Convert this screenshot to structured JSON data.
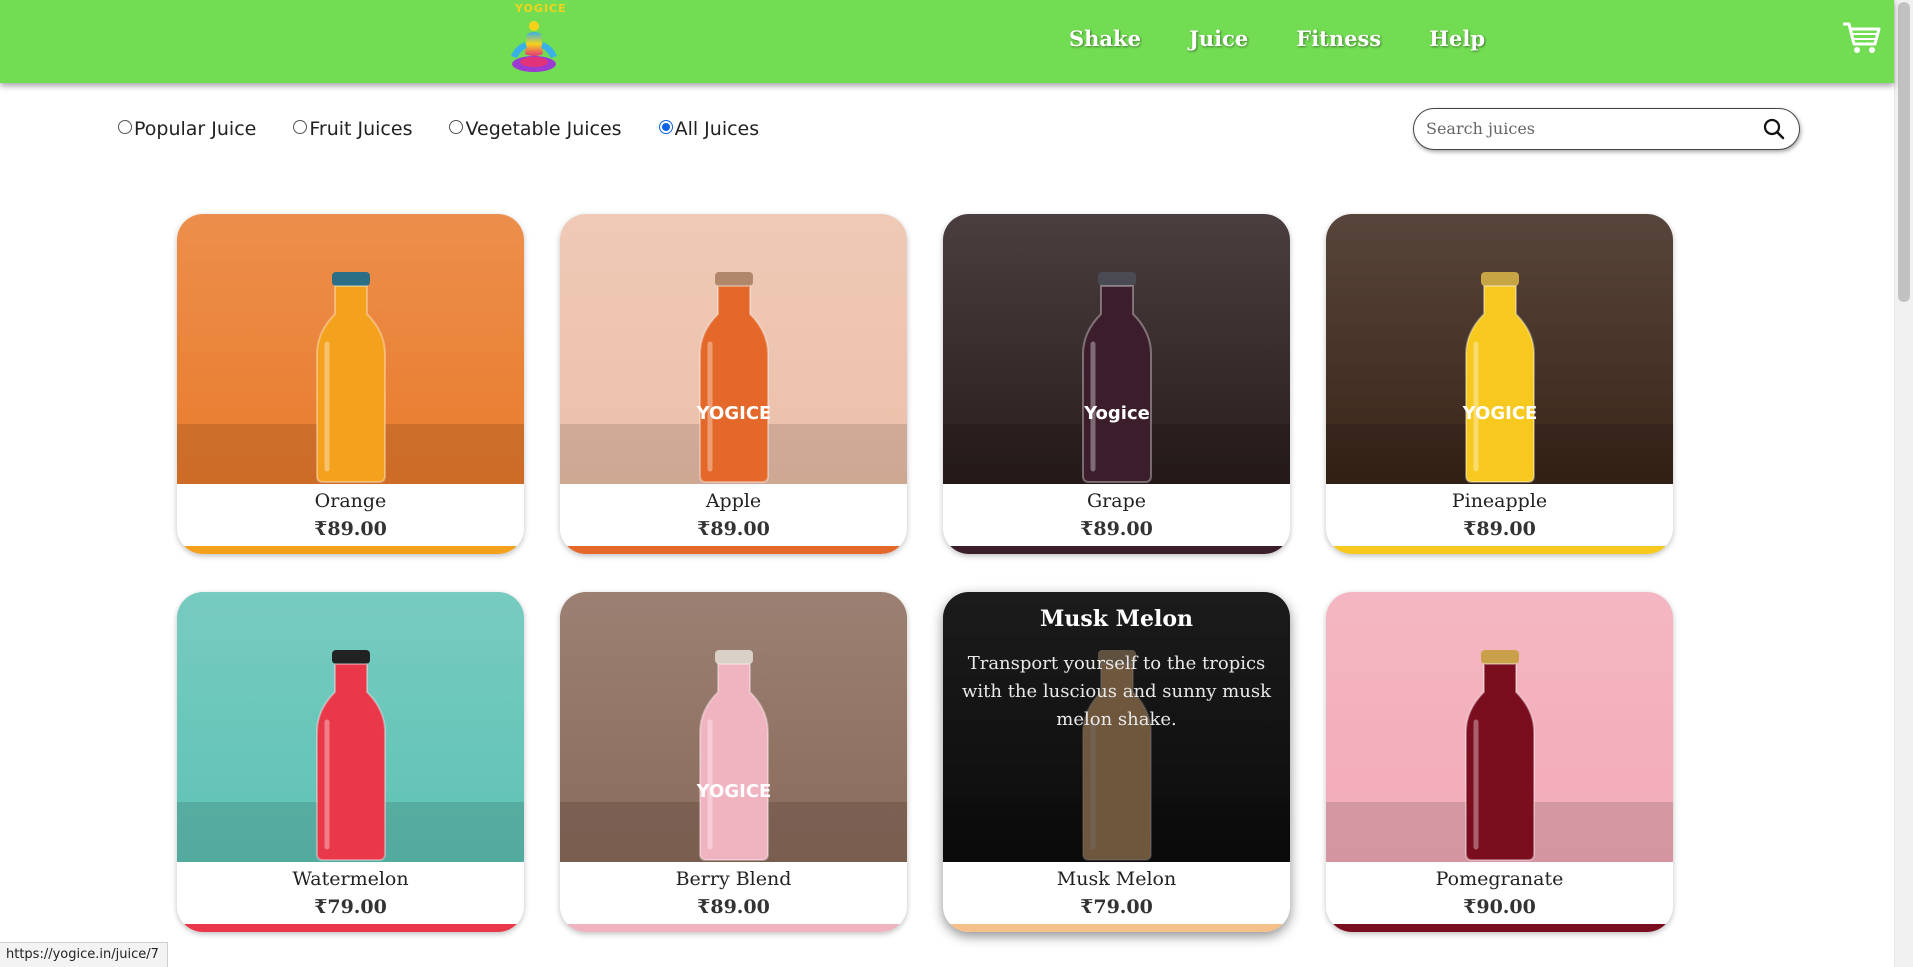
{
  "brand": {
    "logo_text": "YOGICE"
  },
  "nav": [
    {
      "label": "Shake"
    },
    {
      "label": "Juice"
    },
    {
      "label": "Fitness"
    },
    {
      "label": "Help"
    }
  ],
  "filters": [
    {
      "label": "Popular Juice",
      "selected": false
    },
    {
      "label": "Fruit Juices",
      "selected": false
    },
    {
      "label": "Vegetable Juices",
      "selected": false
    },
    {
      "label": "All Juices",
      "selected": true
    }
  ],
  "search": {
    "placeholder": "Search juices",
    "value": ""
  },
  "products": [
    {
      "name": "Orange",
      "price": "₹89.00",
      "bottle_label": "",
      "bg": "#e97b2c",
      "liquid": "#f4a21e",
      "cap": "#2a6f86"
    },
    {
      "name": "Apple",
      "price": "₹89.00",
      "bottle_label": "YOGICE",
      "bg": "#ecc0a9",
      "liquid": "#e4682a",
      "cap": "#b0876a"
    },
    {
      "name": "Grape",
      "price": "₹89.00",
      "bottle_label": "Yogice",
      "bg": "#2a1c1c",
      "liquid": "#3b1d2c",
      "cap": "#4a4a52"
    },
    {
      "name": "Pineapple",
      "price": "₹89.00",
      "bottle_label": "YOGICE",
      "bg": "#3a2418",
      "liquid": "#f7c81e",
      "cap": "#c7a545"
    },
    {
      "name": "Watermelon",
      "price": "₹79.00",
      "bottle_label": "",
      "bg": "#5fc2b5",
      "liquid": "#e8384a",
      "cap": "#222222"
    },
    {
      "name": "Berry Blend",
      "price": "₹89.00",
      "bottle_label": "YOGICE",
      "bg": "#8a6a5a",
      "liquid": "#f0b3c0",
      "cap": "#d9d0c8"
    },
    {
      "name": "Musk Melon",
      "price": "₹79.00",
      "bottle_label": "",
      "bg": "#1b1b1b",
      "liquid": "#f6c08a",
      "cap": "#d0b48c"
    },
    {
      "name": "Pomegranate",
      "price": "₹90.00",
      "bottle_label": "",
      "bg": "#f2aab7",
      "liquid": "#7a0d1e",
      "cap": "#c9a049"
    }
  ],
  "hover_card": {
    "title": "Musk Melon",
    "description": "Transport yourself to the tropics with the luscious and sunny musk melon shake."
  },
  "status_bar": {
    "url": "https://yogice.in/juice/7"
  },
  "colors": {
    "header": "#72dd52",
    "radio_selected": "#0b63e5"
  },
  "icons": {
    "cart": "cart-icon",
    "search": "search-icon",
    "logo": "yoga-figure-logo"
  }
}
